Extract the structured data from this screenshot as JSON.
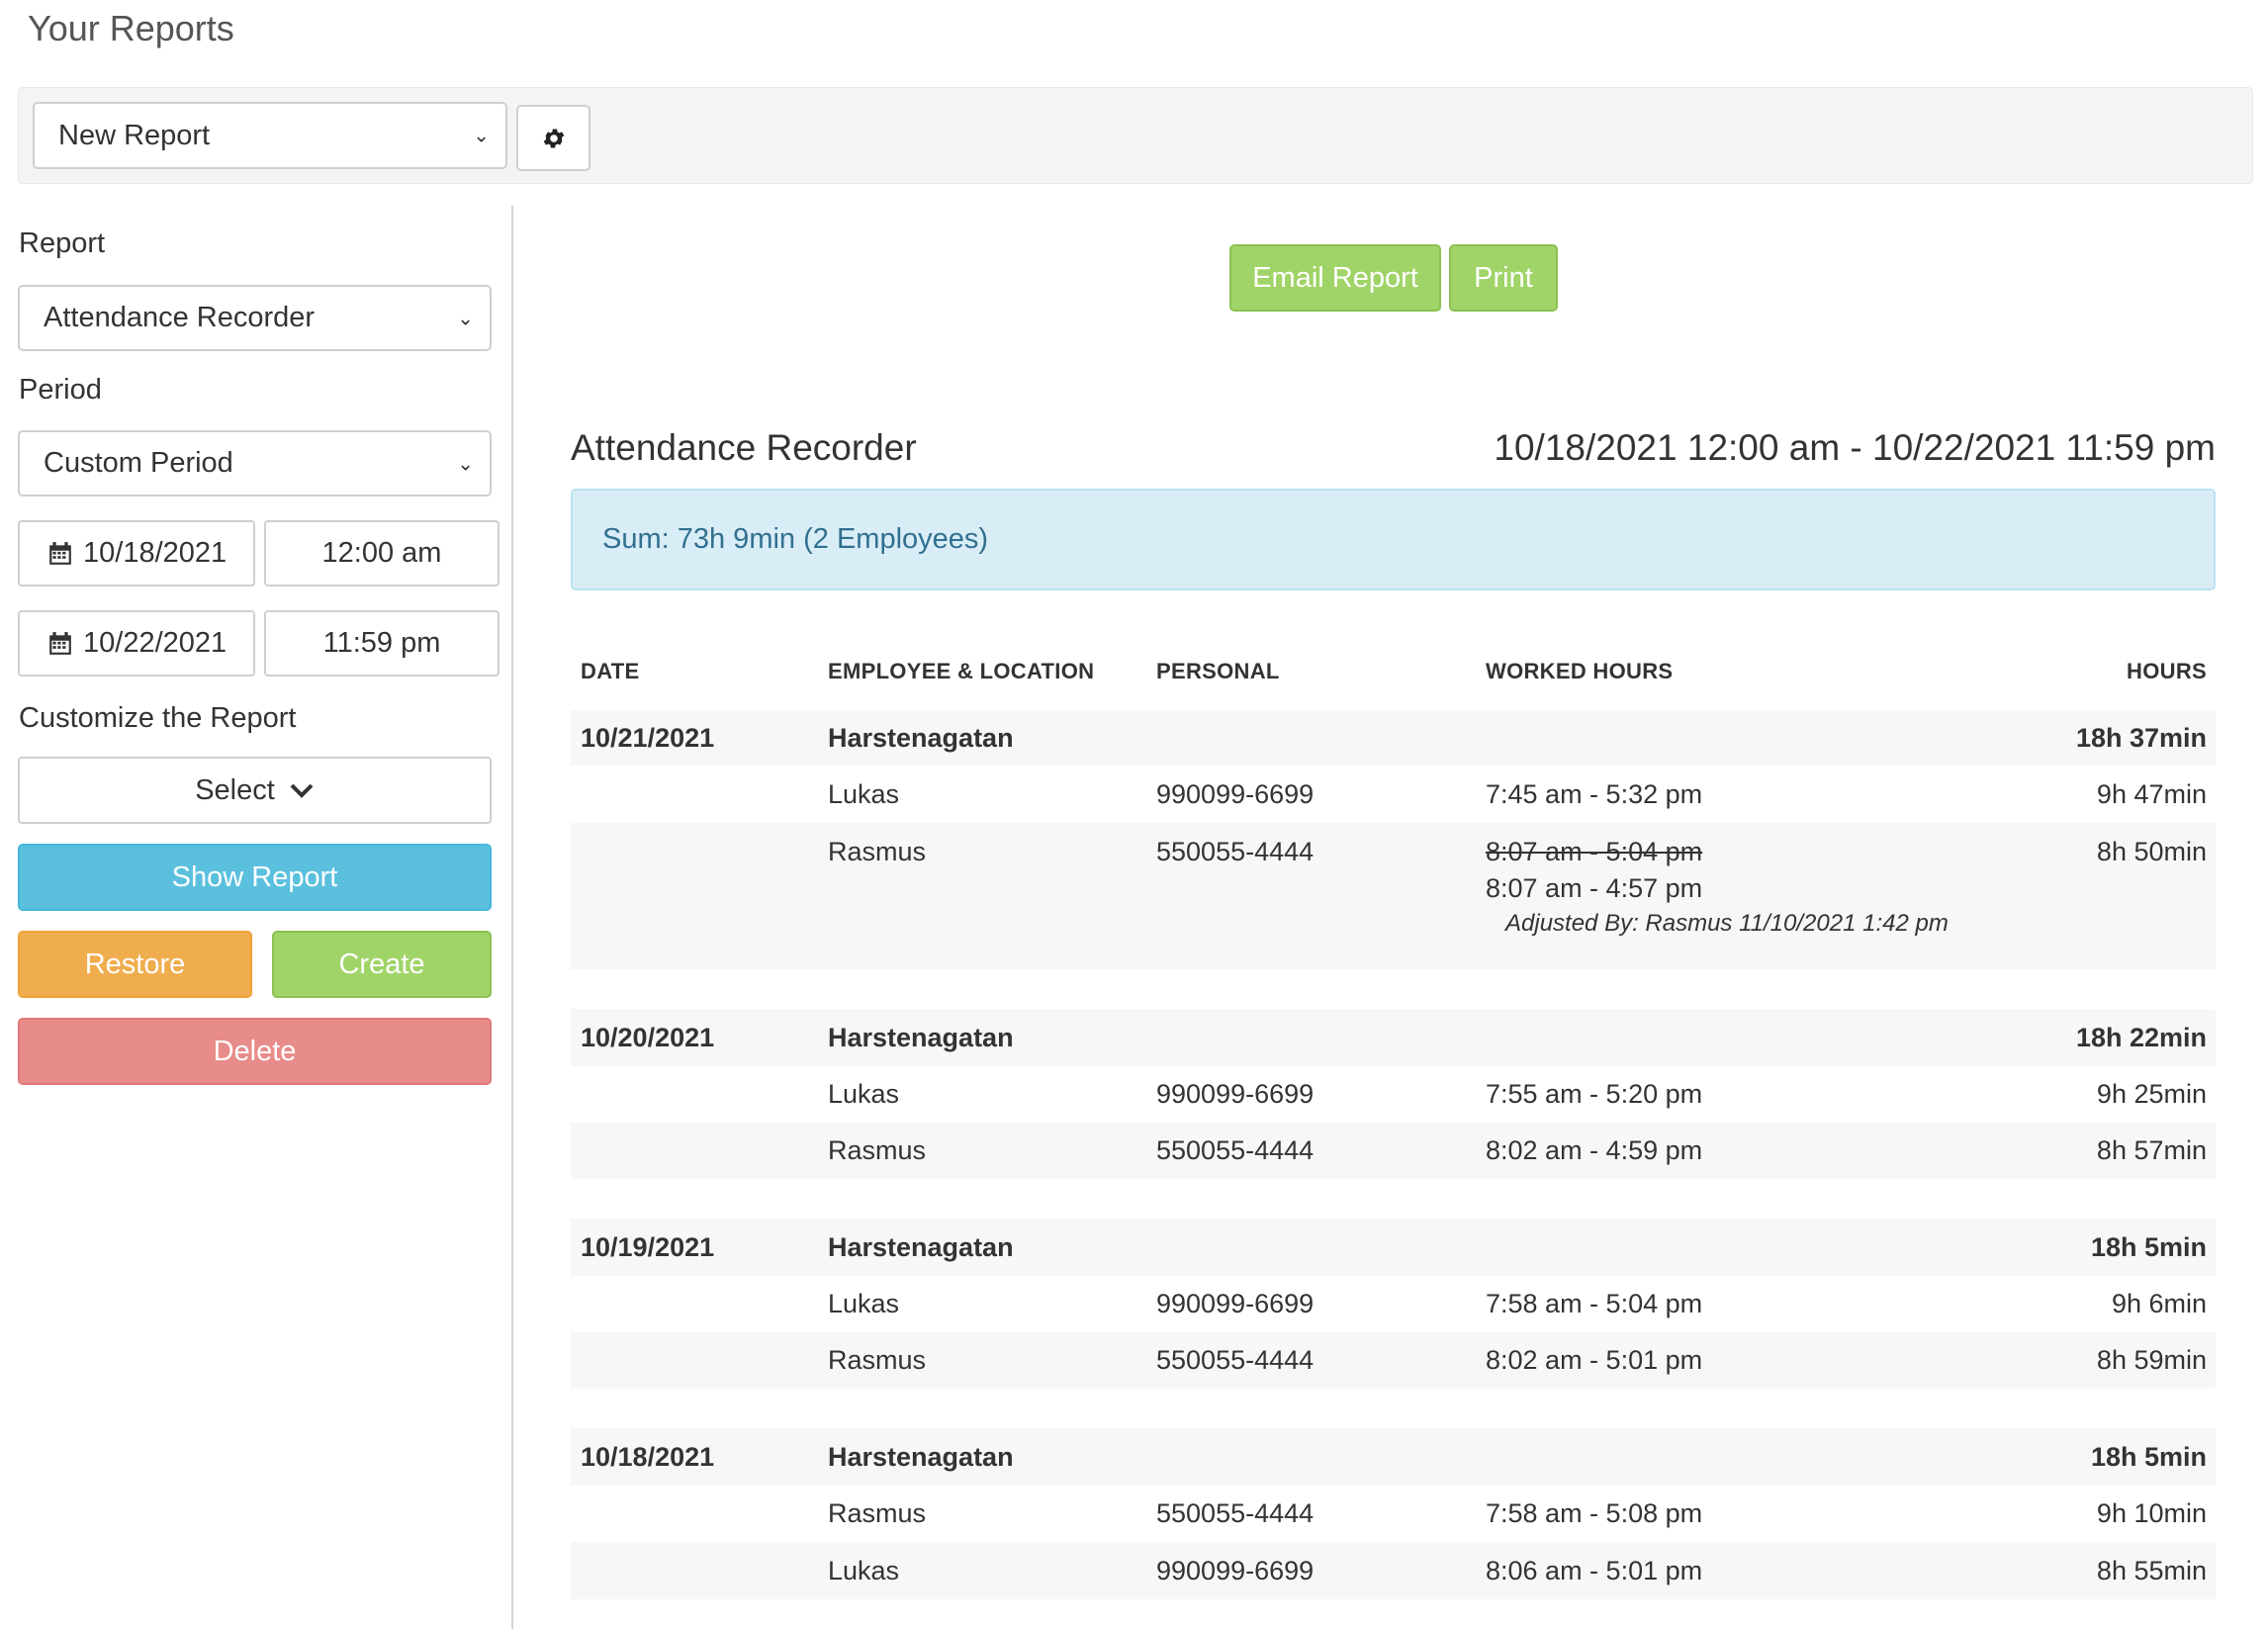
{
  "page_title": "Your Reports",
  "toolbar": {
    "report_select_value": "New Report"
  },
  "sidebar": {
    "report_label": "Report",
    "report_value": "Attendance Recorder",
    "period_label": "Period",
    "period_value": "Custom Period",
    "start_date": "10/18/2021",
    "start_time": "12:00 am",
    "end_date": "10/22/2021",
    "end_time": "11:59 pm",
    "customize_label": "Customize the Report",
    "customize_value": "Select",
    "show_report_label": "Show Report",
    "restore_label": "Restore",
    "create_label": "Create",
    "delete_label": "Delete"
  },
  "actions": {
    "email_label": "Email Report",
    "print_label": "Print"
  },
  "report": {
    "title": "Attendance Recorder",
    "range": "10/18/2021 12:00 am - 10/22/2021 11:59 pm",
    "sum": "Sum: 73h 9min (2 Employees)",
    "headers": {
      "date": "DATE",
      "employee": "EMPLOYEE & LOCATION",
      "personal": "PERSONAL",
      "worked": "WORKED HOURS",
      "hours": "HOURS"
    },
    "groups": [
      {
        "date": "10/21/2021",
        "location": "Harstenagatan",
        "total": "18h 37min",
        "rows": [
          {
            "name": "Lukas",
            "personal": "990099-6699",
            "worked": "7:45 am - 5:32 pm",
            "hours": "9h 47min"
          },
          {
            "name": "Rasmus",
            "personal": "550055-4444",
            "worked_original": "8:07 am - 5:04 pm",
            "worked": "8:07 am - 4:57 pm",
            "adjusted": "Adjusted By: Rasmus 11/10/2021 1:42 pm",
            "hours": "8h 50min"
          }
        ]
      },
      {
        "date": "10/20/2021",
        "location": "Harstenagatan",
        "total": "18h 22min",
        "rows": [
          {
            "name": "Lukas",
            "personal": "990099-6699",
            "worked": "7:55 am - 5:20 pm",
            "hours": "9h 25min"
          },
          {
            "name": "Rasmus",
            "personal": "550055-4444",
            "worked": "8:02 am - 4:59 pm",
            "hours": "8h 57min"
          }
        ]
      },
      {
        "date": "10/19/2021",
        "location": "Harstenagatan",
        "total": "18h 5min",
        "rows": [
          {
            "name": "Lukas",
            "personal": "990099-6699",
            "worked": "7:58 am - 5:04 pm",
            "hours": "9h 6min"
          },
          {
            "name": "Rasmus",
            "personal": "550055-4444",
            "worked": "8:02 am - 5:01 pm",
            "hours": "8h 59min"
          }
        ]
      },
      {
        "date": "10/18/2021",
        "location": "Harstenagatan",
        "total": "18h 5min",
        "rows": [
          {
            "name": "Rasmus",
            "personal": "550055-4444",
            "worked": "7:58 am - 5:08 pm",
            "hours": "9h 10min"
          },
          {
            "name": "Lukas",
            "personal": "990099-6699",
            "worked": "8:06 am - 5:01 pm",
            "hours": "8h 55min"
          }
        ]
      }
    ]
  },
  "colors": {
    "info": "#5bc0de",
    "warning": "#f0ad4e",
    "success": "#a0d468",
    "danger": "#e78c8a",
    "sum_bg": "#d9edf7",
    "sum_text": "#31708f"
  }
}
